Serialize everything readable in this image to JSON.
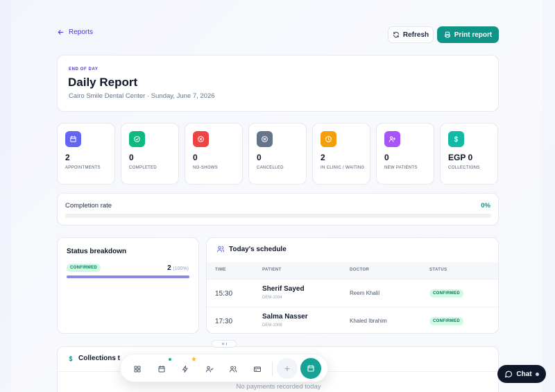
{
  "nav": {
    "back_label": "Reports"
  },
  "actions": {
    "refresh_label": "Refresh",
    "print_label": "Print report"
  },
  "header": {
    "eyebrow": "END OF DAY",
    "title": "Daily Report",
    "subtitle": "Cairo Smile Dental Center · Sunday, June 7, 2026"
  },
  "stats": [
    {
      "value": "2",
      "label": "APPOINTMENTS",
      "icon": "calendar-icon",
      "color": "#6366f1"
    },
    {
      "value": "0",
      "label": "COMPLETED",
      "icon": "check-circle-icon",
      "color": "#10b981"
    },
    {
      "value": "0",
      "label": "NO-SHOWS",
      "icon": "x-circle-icon",
      "color": "#ef4444"
    },
    {
      "value": "0",
      "label": "CANCELLED",
      "icon": "ban-icon",
      "color": "#64748b"
    },
    {
      "value": "2",
      "label": "IN CLINIC / WAITING",
      "icon": "clock-icon",
      "color": "#f59e0b"
    },
    {
      "value": "0",
      "label": "NEW PATIENTS",
      "icon": "user-plus-icon",
      "color": "#a855f7"
    },
    {
      "value": "EGP 0",
      "label": "COLLECTIONS",
      "icon": "dollar-icon",
      "color": "#14b8a6"
    }
  ],
  "completion": {
    "label": "Completion rate",
    "value_text": "0%",
    "fraction": 0
  },
  "status_breakdown": {
    "title": "Status breakdown",
    "items": [
      {
        "label": "CONFIRMED",
        "count": "2",
        "percent_text": "(100%)",
        "fraction": 1
      }
    ]
  },
  "schedule": {
    "title": "Today's schedule",
    "columns": [
      "TIME",
      "PATIENT",
      "DOCTOR",
      "STATUS"
    ],
    "rows": [
      {
        "time": "15:30",
        "patient": "Sherif Sayed",
        "patient_id": "DEM-1034",
        "doctor": "Reem Khalil",
        "status": "CONFIRMED"
      },
      {
        "time": "17:30",
        "patient": "Salma Nasser",
        "patient_id": "DEM-1006",
        "doctor": "Khaled Ibrahim",
        "status": "CONFIRMED"
      }
    ]
  },
  "collections": {
    "title": "Collections t",
    "empty_text": "No payments recorded today"
  },
  "dock": {
    "items": [
      "grid-icon",
      "calendar-icon",
      "bolt-icon",
      "user-check-icon",
      "users-icon",
      "card-icon"
    ],
    "plus_label": "+",
    "active_item": "calendar-icon"
  },
  "chat": {
    "label": "Chat"
  },
  "colors": {
    "accent": "#0f9488",
    "brand": "#4338ca"
  }
}
